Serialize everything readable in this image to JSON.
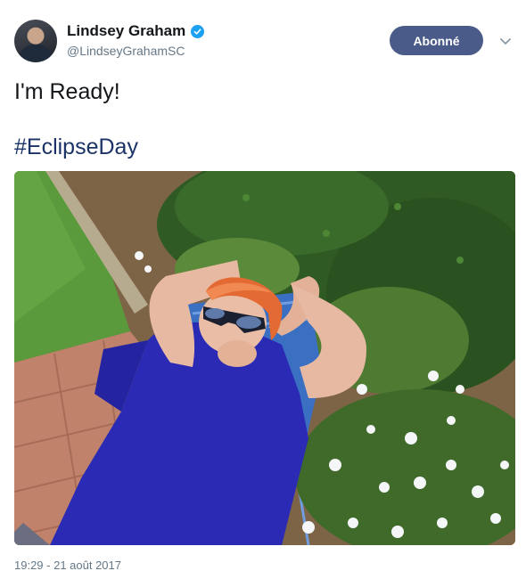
{
  "author": {
    "name": "Lindsey Graham",
    "handle": "@LindseyGrahamSC",
    "verified": true
  },
  "actions": {
    "follow_label": "Abonné"
  },
  "tweet": {
    "line1": "I'm Ready!",
    "hashtag": "#EclipseDay",
    "timestamp": "19:29 - 21 août 2017"
  },
  "colors": {
    "follow_bg": "#4a5b8a",
    "hashtag": "#1b3366",
    "verified": "#1da1f2",
    "muted": "#657786"
  },
  "icons": {
    "verified": "verified-badge-icon",
    "caret": "chevron-down-icon"
  }
}
